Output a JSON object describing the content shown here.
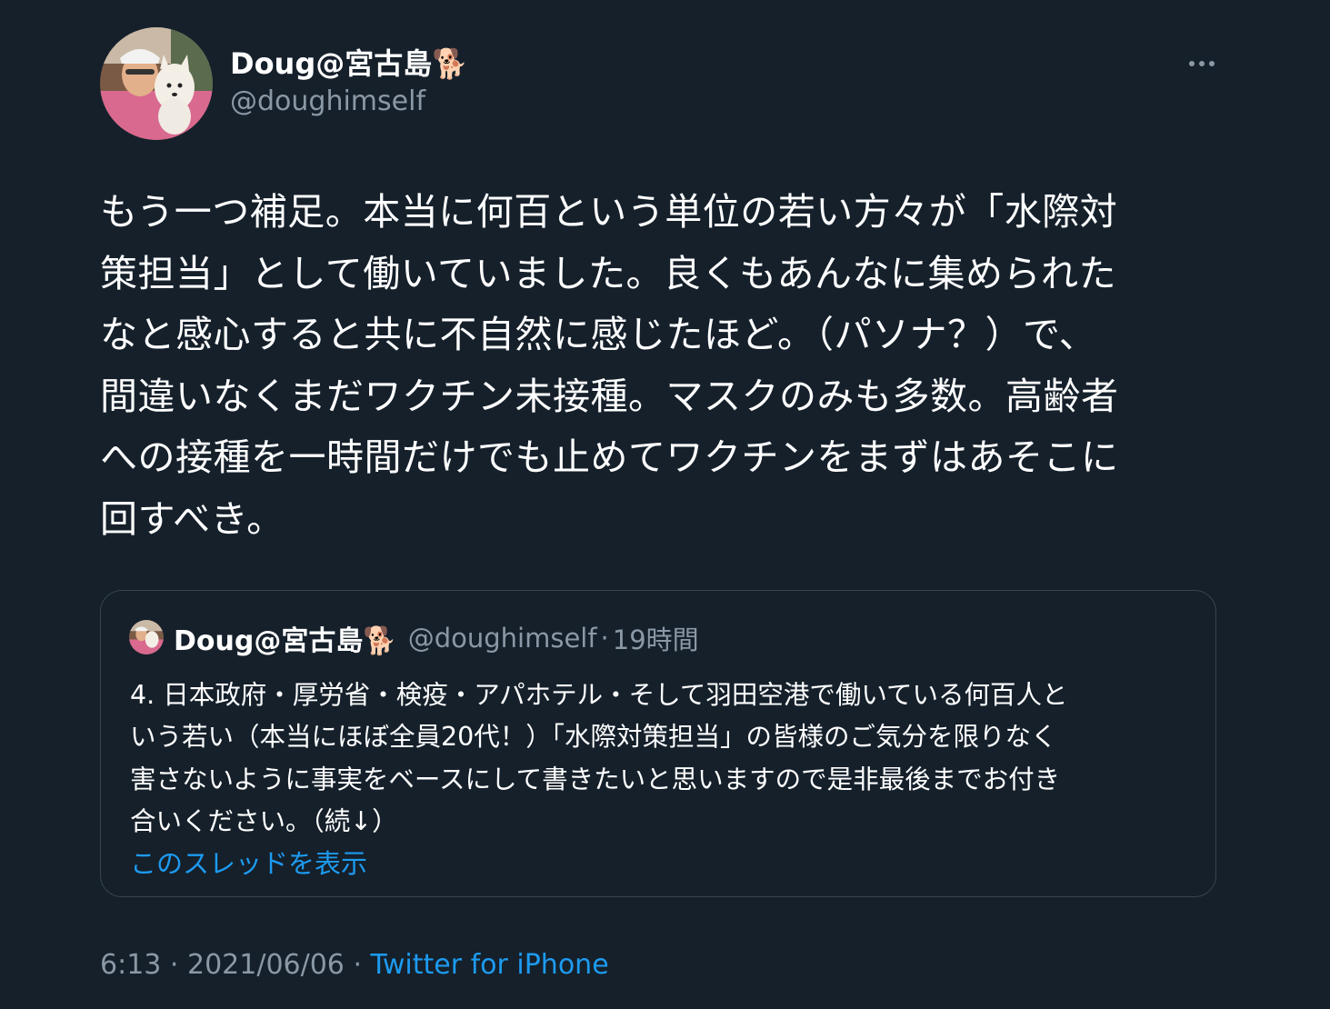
{
  "author": {
    "display_name": "Doug@宮古島🐕",
    "handle": "@doughimself",
    "avatar_icon": "profile-photo-man-holding-dog"
  },
  "menu": {
    "more_icon": "more-horizontal-icon"
  },
  "tweet": {
    "text": "もう一つ補足。本当に何百という単位の若い方々が「水際対\n策担当」として働いていました。良くもあんなに集められた\nなと感心すると共に不自然に感じたほど。（パソナ？）で、\n間違いなくまだワクチン未接種。マスクのみも多数。高齢者\nへの接種を一時間だけでも止めてワクチンをまずはあそこに\n回すべき。"
  },
  "quoted_tweet": {
    "display_name": "Doug@宮古島🐕",
    "handle": "@doughimself",
    "separator": "·",
    "time": "19時間",
    "text": "4. 日本政府・厚労省・検疫・アパホテル・そして羽田空港で働いている何百人と\nいう若い（本当にほぼ全員20代！）「水際対策担当」の皆様のご気分を限りなく\n害さないように事実をベースにして書きたいと思いますので是非最後までお付き\n合いください。（続↓）",
    "show_thread": "このスレッドを表示"
  },
  "footer": {
    "time": "6:13",
    "separator1": " · ",
    "date": "2021/06/06",
    "separator2": " · ",
    "source": "Twitter for iPhone"
  },
  "colors": {
    "background": "#15202b",
    "text": "#ffffff",
    "secondary": "#8b98a5",
    "link": "#1d9bf0",
    "border": "#38444d"
  }
}
